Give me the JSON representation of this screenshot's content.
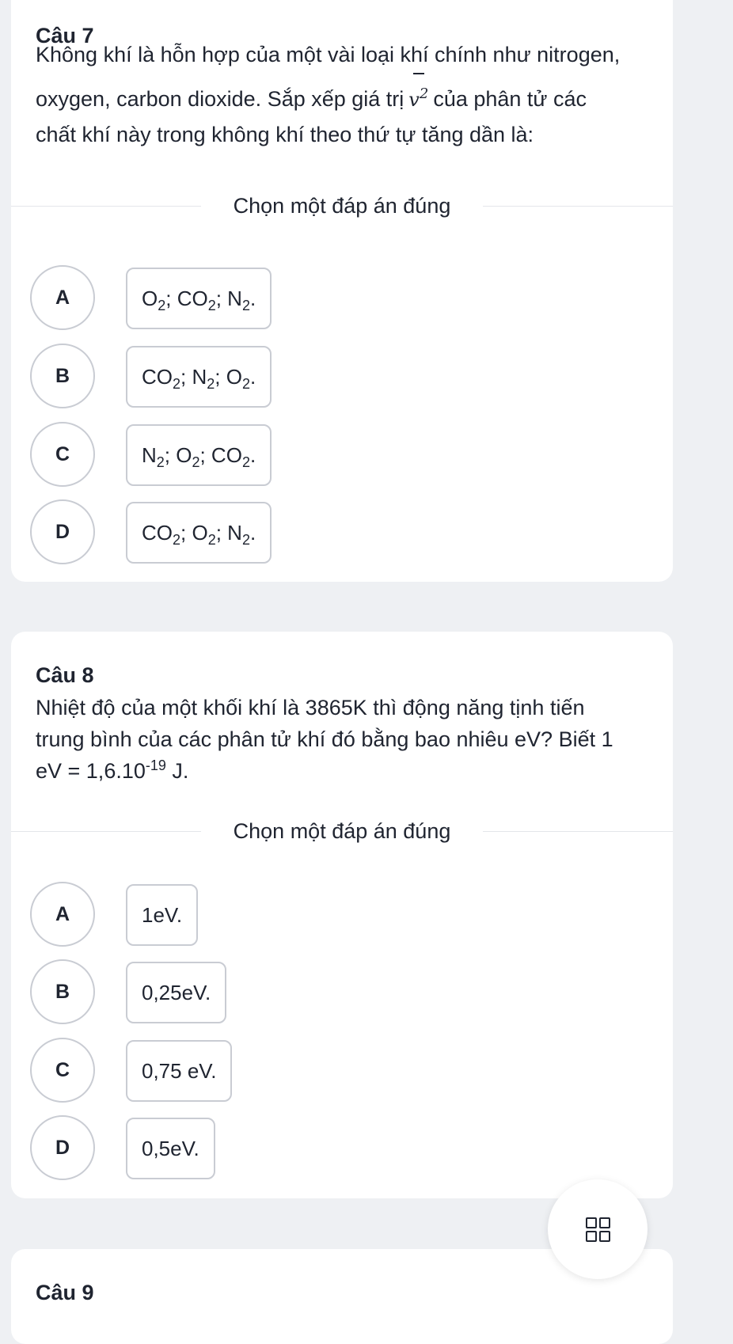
{
  "questions": [
    {
      "title": "Câu 7",
      "text_lines": [
        "Không khí là hỗn hợp của một vài loại khí chính như nitrogen,",
        "oxygen, carbon dioxide. Sắp xếp giá trị",
        "của phân tử các",
        "chất khí này trong không khí theo thứ tự tăng dần là:"
      ],
      "formula_symbol": "v",
      "formula_exponent": "2",
      "prompt": "Chọn một đáp án đúng",
      "options": [
        {
          "letter": "A",
          "parts": [
            "O",
            "2",
            "; CO",
            "2",
            "; N",
            "2",
            "."
          ]
        },
        {
          "letter": "B",
          "parts": [
            "CO",
            "2",
            "; N",
            "2",
            "; O",
            "2",
            "."
          ]
        },
        {
          "letter": "C",
          "parts": [
            "N",
            "2",
            "; O",
            "2",
            "; CO",
            "2",
            "."
          ]
        },
        {
          "letter": "D",
          "parts": [
            "CO",
            "2",
            "; O",
            "2",
            "; N",
            "2",
            "."
          ]
        }
      ]
    },
    {
      "title": "Câu 8",
      "text_lines": [
        "Nhiệt độ của một khối khí là 3865K thì động năng tịnh tiến",
        "trung bình của các phân tử khí đó bằng bao nhiêu eV? Biết 1"
      ],
      "eV_def": {
        "prefix": "eV = 1,6.10",
        "exponent": "-19",
        "suffix": " J."
      },
      "prompt": "Chọn một đáp án đúng",
      "options": [
        {
          "letter": "A",
          "text": "1eV."
        },
        {
          "letter": "B",
          "text": "0,25eV."
        },
        {
          "letter": "C",
          "text": "0,75 eV."
        },
        {
          "letter": "D",
          "text": "0,5eV."
        }
      ]
    },
    {
      "title": "Câu 9"
    }
  ],
  "fab_icon": "grid-icon"
}
